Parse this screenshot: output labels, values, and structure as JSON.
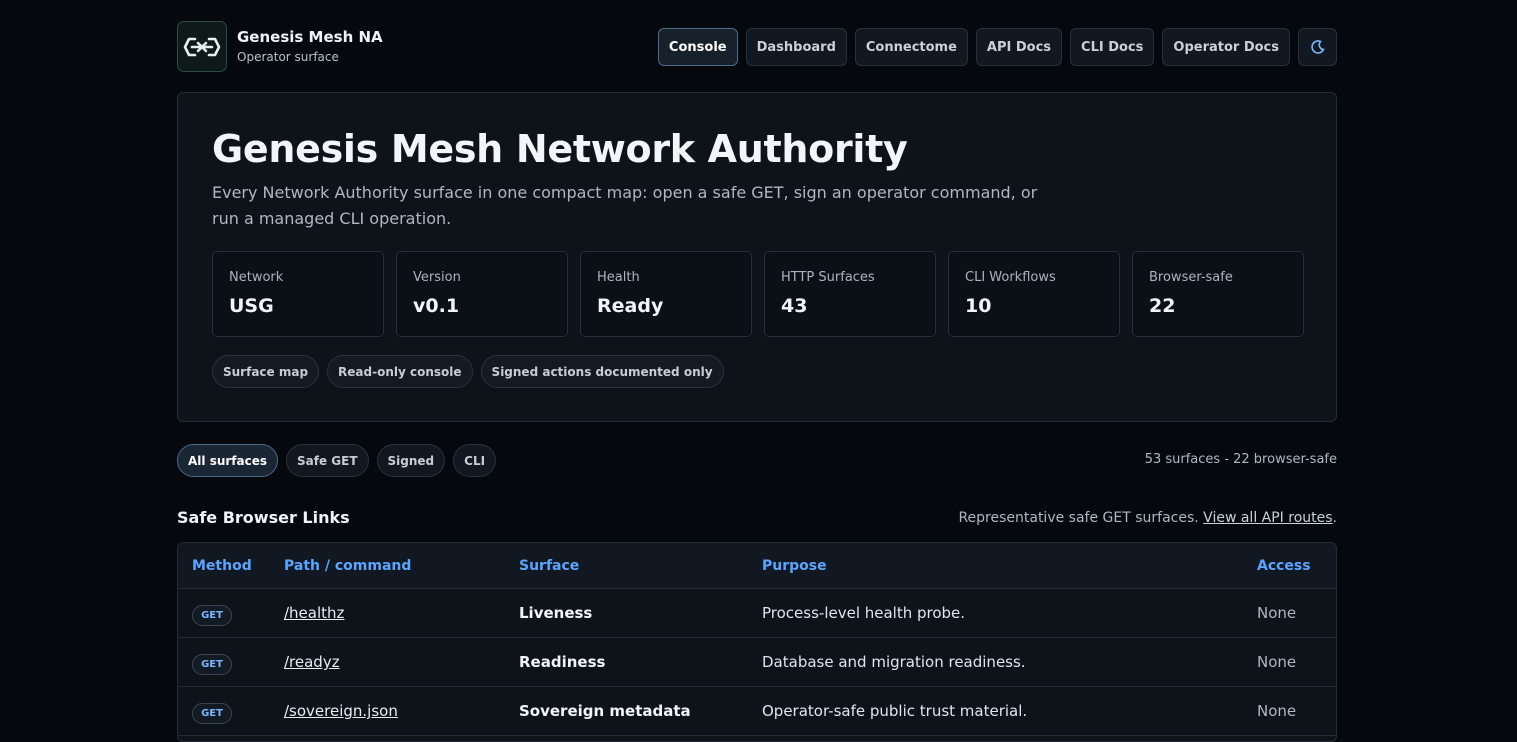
{
  "brand": {
    "name": "Genesis Mesh NA",
    "subtitle": "Operator surface",
    "logo_icon": "mesh-link-icon"
  },
  "nav": [
    {
      "label": "Console",
      "active": true
    },
    {
      "label": "Dashboard"
    },
    {
      "label": "Connectome"
    },
    {
      "label": "API Docs"
    },
    {
      "label": "CLI Docs"
    },
    {
      "label": "Operator Docs"
    }
  ],
  "theme_toggle": {
    "icon": "moon-icon"
  },
  "hero": {
    "title": "Genesis Mesh Network Authority",
    "description": "Every Network Authority surface in one compact map: open a safe GET, sign an operator command, or run a managed CLI operation.",
    "stats": [
      {
        "label": "Network",
        "value": "USG"
      },
      {
        "label": "Version",
        "value": "v0.1"
      },
      {
        "label": "Health",
        "value": "Ready"
      },
      {
        "label": "HTTP Surfaces",
        "value": "43"
      },
      {
        "label": "CLI Workflows",
        "value": "10"
      },
      {
        "label": "Browser-safe",
        "value": "22"
      }
    ],
    "chips": [
      "Surface map",
      "Read-only console",
      "Signed actions documented only"
    ]
  },
  "filters": [
    {
      "label": "All surfaces",
      "active": true
    },
    {
      "label": "Safe GET"
    },
    {
      "label": "Signed"
    },
    {
      "label": "CLI"
    }
  ],
  "summary": "53 surfaces - 22 browser-safe",
  "section": {
    "title": "Safe Browser Links",
    "note": "Representative safe GET surfaces. ",
    "note_link": "View all API routes",
    "note_end": "."
  },
  "table": {
    "headers": {
      "method": "Method",
      "path": "Path / command",
      "surface": "Surface",
      "purpose": "Purpose",
      "access": "Access"
    },
    "rows": [
      {
        "method": "GET",
        "path": "/healthz",
        "surface": "Liveness",
        "purpose": "Process-level health probe.",
        "access": "None"
      },
      {
        "method": "GET",
        "path": "/readyz",
        "surface": "Readiness",
        "purpose": "Database and migration readiness.",
        "access": "None"
      },
      {
        "method": "GET",
        "path": "/sovereign.json",
        "surface": "Sovereign metadata",
        "purpose": "Operator-safe public trust material.",
        "access": "None"
      }
    ]
  },
  "colors": {
    "accent": "#58a6ff",
    "background": "#05080d",
    "panel": "#0e131a"
  }
}
